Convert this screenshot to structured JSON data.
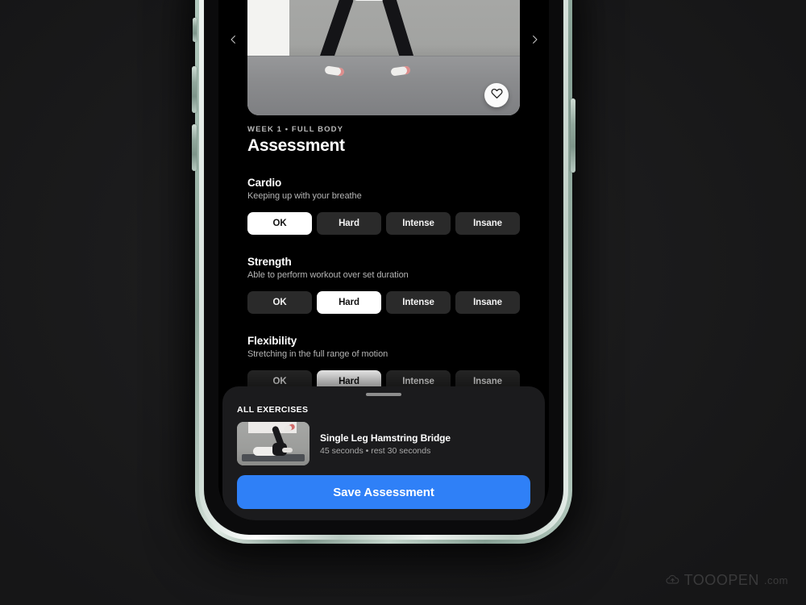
{
  "app": {
    "eyebrow": "WEEK 1 • FULL BODY",
    "title": "Assessment"
  },
  "hero": {
    "prev_icon": "chevron-left-icon",
    "next_icon": "chevron-right-icon",
    "favorite_icon": "heart-icon"
  },
  "questions": [
    {
      "title": "Cardio",
      "subtitle": "Keeping up with your breathe",
      "options": [
        "OK",
        "Hard",
        "Intense",
        "Insane"
      ],
      "selected": "OK"
    },
    {
      "title": "Strength",
      "subtitle": "Able to perform workout over set duration",
      "options": [
        "OK",
        "Hard",
        "Intense",
        "Insane"
      ],
      "selected": "Hard"
    },
    {
      "title": "Flexibility",
      "subtitle": "Stretching in the full range of motion",
      "options": [
        "OK",
        "Hard",
        "Intense",
        "Insane"
      ],
      "selected": "Hard"
    }
  ],
  "sheet": {
    "label": "ALL EXERCISES",
    "exercises": [
      {
        "name": "Single Leg Hamstring Bridge",
        "duration": "45 seconds • rest 30 seconds"
      }
    ],
    "save_label": "Save Assessment"
  },
  "watermark": {
    "icon": "cloud-upload-icon",
    "name": "TOOOPEN",
    "suffix": ".com"
  },
  "colors": {
    "accent_blue": "#2f80f7",
    "screen_bg": "#000000",
    "sheet_bg": "#1b1b1d",
    "option_bg": "#2a2a2a",
    "option_selected_bg": "#ffffff",
    "backdrop": "#1a1a1b",
    "device_frame": "#a9c1b5"
  }
}
